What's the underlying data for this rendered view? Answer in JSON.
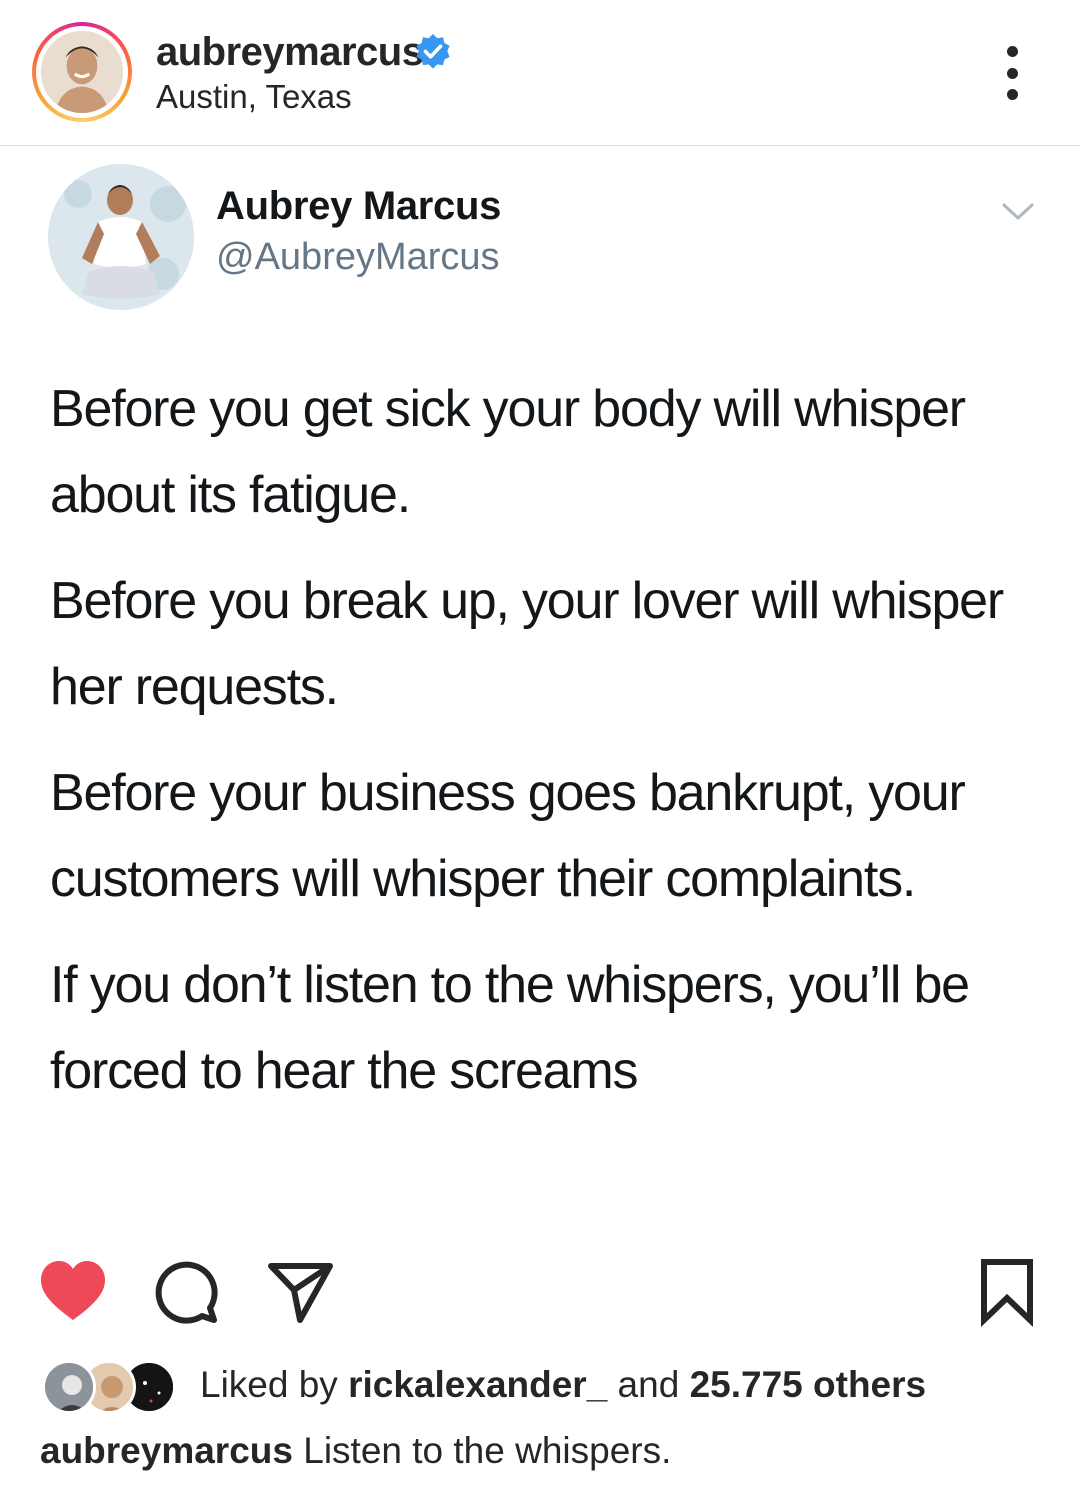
{
  "post": {
    "username": "aubreymarcus",
    "location": "Austin, Texas",
    "verified_icon": "verified-badge-icon",
    "more_icon": "more-options-icon"
  },
  "tweet": {
    "display_name": "Aubrey Marcus",
    "handle": "@AubreyMarcus",
    "paragraphs": [
      "Before you get sick your body will whisper about its fatigue.",
      "Before you break up, your lover will whisper her requests.",
      "Before your business goes bankrupt, your customers will whisper their complaints.",
      "If you don’t listen to the whispers, you’ll be forced to hear the screams"
    ]
  },
  "actions": {
    "like_icon": "heart-filled-icon",
    "comment_icon": "comment-icon",
    "share_icon": "share-icon",
    "save_icon": "bookmark-icon",
    "like_color": "#ed4956"
  },
  "likes": {
    "prefix": "Liked by ",
    "liker": "rickalexander_",
    "middle": " and ",
    "count": "25.775 others"
  },
  "caption": {
    "username": "aubreymarcus",
    "text": " Listen to the whispers."
  }
}
